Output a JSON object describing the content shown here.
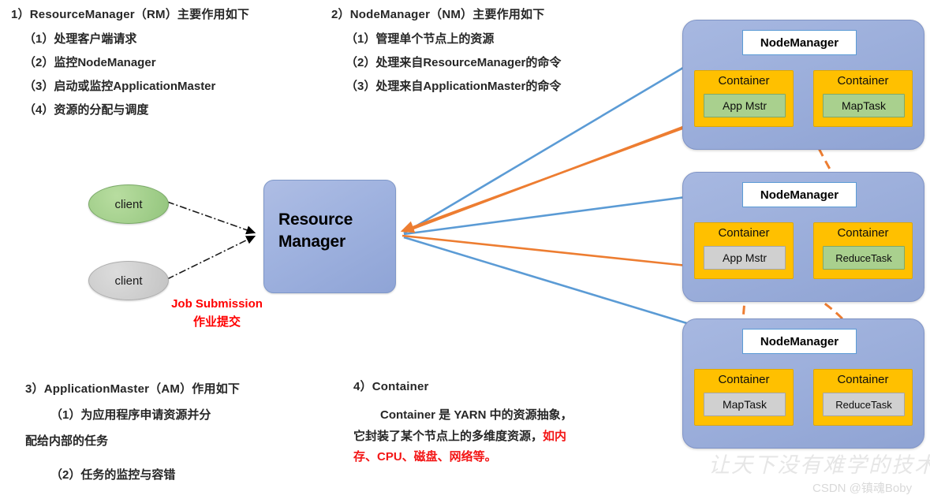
{
  "colors": {
    "panel_blue": "#9aadda",
    "container_orange": "#ffc000",
    "task_green": "#a9d08e",
    "task_gray": "#d0d0d0",
    "arrow_blue": "#5b9bd5",
    "arrow_orange": "#ed7d31",
    "red_text": "#ff0000"
  },
  "sections": {
    "rm": {
      "heading": "1）ResourceManager（RM）主要作用如下",
      "items": [
        "（1）处理客户端请求",
        "（2）监控NodeManager",
        "（3）启动或监控ApplicationMaster",
        "（4）资源的分配与调度"
      ]
    },
    "nm": {
      "heading": "2）NodeManager（NM）主要作用如下",
      "items": [
        "（1）管理单个节点上的资源",
        "（2）处理来自ResourceManager的命令",
        "（3）处理来自ApplicationMaster的命令"
      ]
    },
    "am": {
      "heading": "3）ApplicationMaster（AM）作用如下",
      "item1_line1": "（1）为应用程序申请资源并分",
      "item1_line2": "配给内部的任务",
      "item2": "（2）任务的监控与容错"
    },
    "container": {
      "heading": "4）Container",
      "para_plain": "Container 是 YARN 中的资源抽象，它封装了某个节点上的多维度资源，",
      "para_red": "如内存、CPU、磁盘、网络等。"
    }
  },
  "diagram": {
    "resource_manager": {
      "line1": "Resource",
      "line2": "Manager"
    },
    "clients": [
      {
        "label": "client",
        "color": "green"
      },
      {
        "label": "client",
        "color": "gray"
      }
    ],
    "job_submission": {
      "en": "Job Submission",
      "zh": "作业提交"
    },
    "node_managers": [
      {
        "title": "NodeManager",
        "containers": [
          {
            "title": "Container",
            "task": "App Mstr",
            "task_style": "green"
          },
          {
            "title": "Container",
            "task": "MapTask",
            "task_style": "green"
          }
        ]
      },
      {
        "title": "NodeManager",
        "containers": [
          {
            "title": "Container",
            "task": "App Mstr",
            "task_style": "gray"
          },
          {
            "title": "Container",
            "task": "ReduceTask",
            "task_style": "green"
          }
        ]
      },
      {
        "title": "NodeManager",
        "containers": [
          {
            "title": "Container",
            "task": "MapTask",
            "task_style": "gray"
          },
          {
            "title": "Container",
            "task": "ReduceTask",
            "task_style": "gray"
          }
        ]
      }
    ]
  },
  "watermark": {
    "slogan": "让天下没有难学的技术",
    "credit": "CSDN @镇魂Boby"
  }
}
